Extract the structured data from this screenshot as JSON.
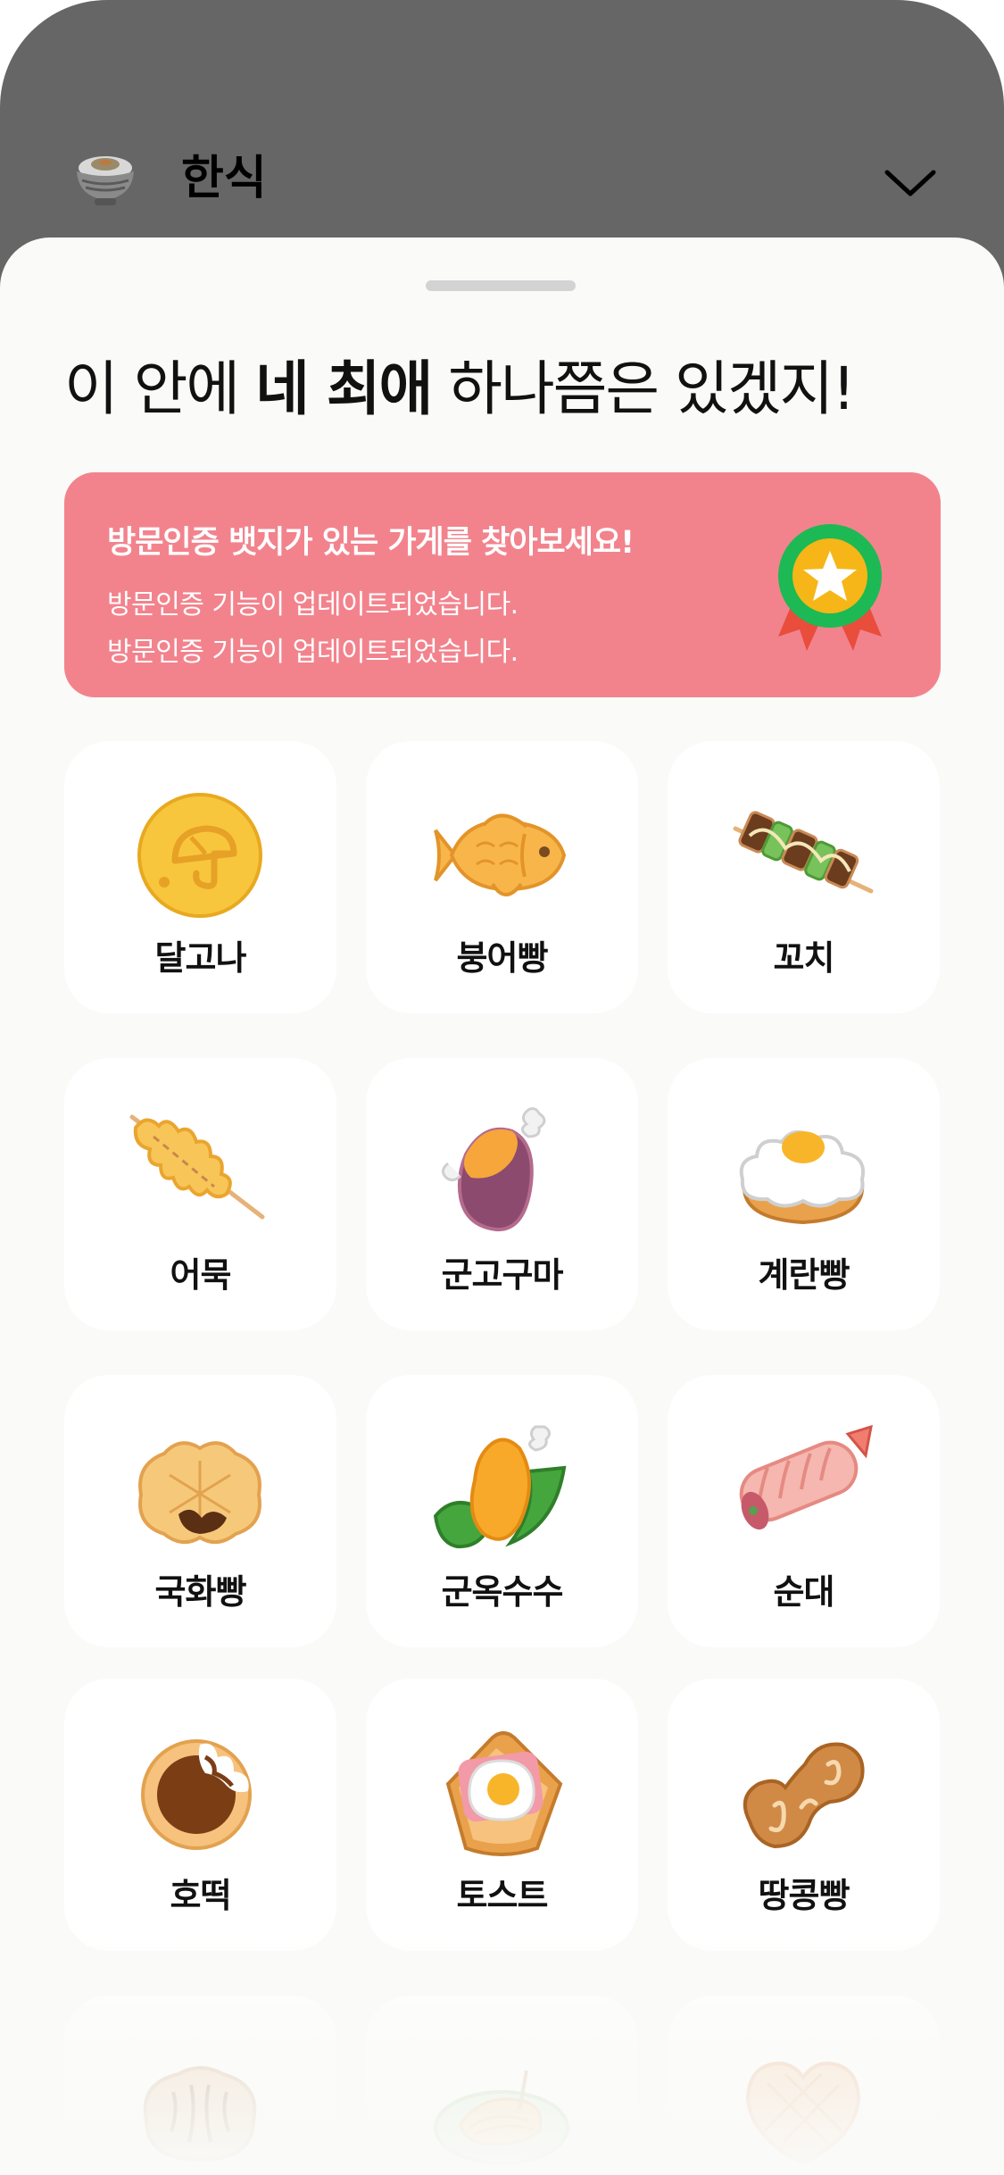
{
  "header": {
    "category_title": "한식",
    "category_icon": "rice-bowl-icon",
    "dropdown_icon": "chevron-down-icon"
  },
  "sheet": {
    "headline_pre": "이 안에 ",
    "headline_bold": "네 최애",
    "headline_post": " 하나쯤은 있겠지!"
  },
  "banner": {
    "title": "방문인증 뱃지가 있는 가게를 찾아보세요!",
    "line1": "방문인증 기능이 업데이트되었습니다.",
    "line2": "방문인증 기능이 업데이트되었습니다.",
    "icon": "medal-icon",
    "color": "#f2838d"
  },
  "items": [
    {
      "label": "달고나",
      "icon": "dalgona-icon"
    },
    {
      "label": "붕어빵",
      "icon": "fish-bread-icon"
    },
    {
      "label": "꼬치",
      "icon": "skewer-icon"
    },
    {
      "label": "어묵",
      "icon": "fish-cake-icon"
    },
    {
      "label": "군고구마",
      "icon": "roasted-sweet-potato-icon"
    },
    {
      "label": "계란빵",
      "icon": "egg-bread-icon"
    },
    {
      "label": "국화빵",
      "icon": "chrysanthemum-bread-icon"
    },
    {
      "label": "군옥수수",
      "icon": "roasted-corn-icon"
    },
    {
      "label": "순대",
      "icon": "sundae-icon"
    },
    {
      "label": "호떡",
      "icon": "hotteok-icon"
    },
    {
      "label": "토스트",
      "icon": "toast-icon"
    },
    {
      "label": "땅콩빵",
      "icon": "peanut-bread-icon"
    },
    {
      "label": "",
      "icon": "walnut-cake-icon"
    },
    {
      "label": "",
      "icon": "noodle-plate-icon"
    },
    {
      "label": "",
      "icon": "waffle-heart-icon"
    }
  ]
}
